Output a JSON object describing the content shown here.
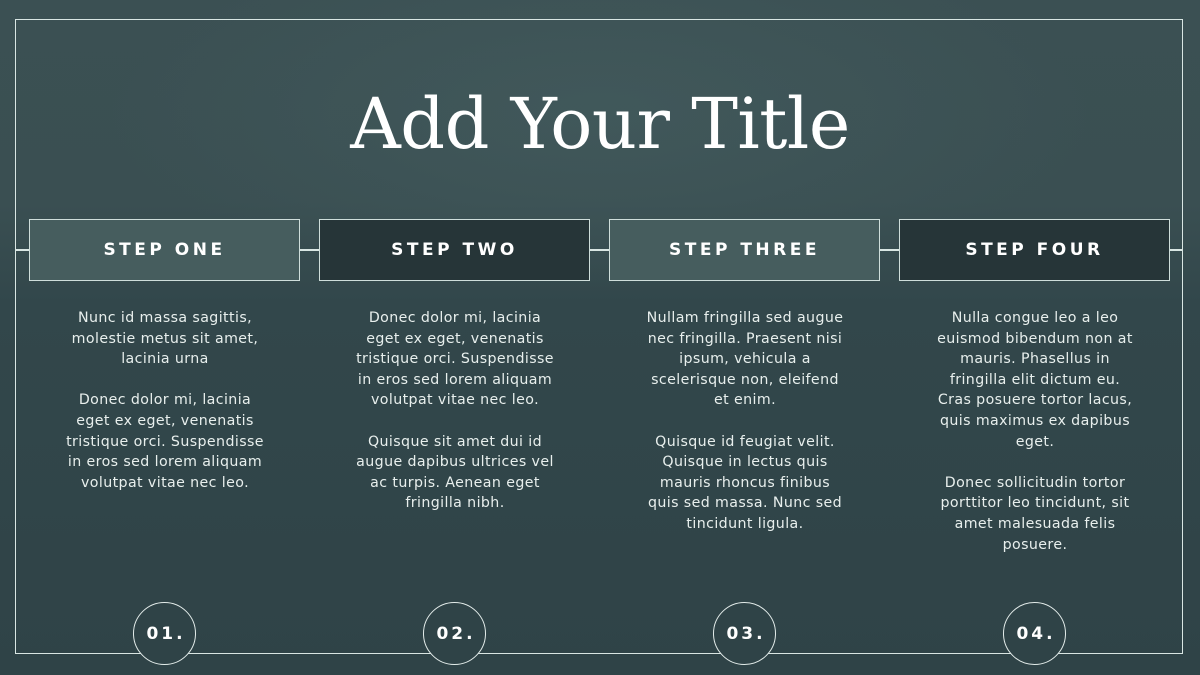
{
  "slide": {
    "title": "Add Your Title",
    "colors": {
      "background": "#2f4347",
      "frame_line": "#d9e6e3",
      "box_light": "#465d5e",
      "box_dark": "#263538",
      "text": "#ffffff"
    },
    "steps": [
      {
        "label": "STEP ONE",
        "style": "light",
        "number": "01.",
        "paragraphs": [
          "Nunc id massa sagittis, molestie metus sit amet, lacinia urna",
          "Donec dolor mi, lacinia eget ex eget, venenatis tristique orci. Suspendisse in eros sed lorem aliquam volutpat vitae nec leo."
        ]
      },
      {
        "label": "STEP TWO",
        "style": "dark",
        "number": "02.",
        "paragraphs": [
          "Donec dolor mi, lacinia eget ex eget, venenatis tristique orci. Suspendisse in eros sed lorem aliquam volutpat vitae nec leo.",
          "Quisque sit amet dui id augue dapibus ultrices vel ac turpis. Aenean eget fringilla nibh."
        ]
      },
      {
        "label": "STEP THREE",
        "style": "light",
        "number": "03.",
        "paragraphs": [
          "Nullam fringilla sed augue nec fringilla. Praesent nisi ipsum, vehicula a scelerisque non, eleifend et enim.",
          "Quisque id feugiat velit. Quisque in lectus quis mauris rhoncus finibus quis sed massa. Nunc sed tincidunt ligula."
        ]
      },
      {
        "label": "STEP FOUR",
        "style": "dark",
        "number": "04.",
        "paragraphs": [
          "Nulla congue leo a leo euismod bibendum non at mauris. Phasellus in fringilla elit dictum eu. Cras posuere tortor lacus, quis maximus ex dapibus eget.",
          "Donec sollicitudin tortor porttitor leo tincidunt, sit amet malesuada felis posuere."
        ]
      }
    ]
  }
}
